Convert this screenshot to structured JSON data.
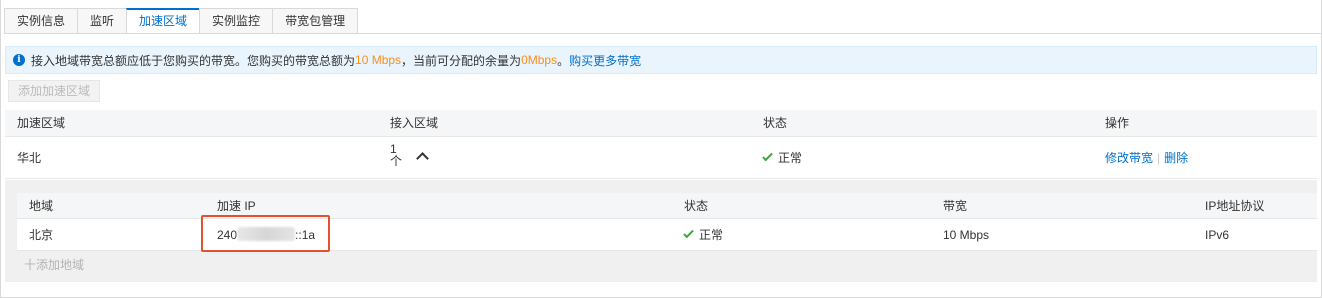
{
  "tabs": [
    {
      "label": "实例信息",
      "active": false
    },
    {
      "label": "监听",
      "active": false
    },
    {
      "label": "加速区域",
      "active": true
    },
    {
      "label": "实例监控",
      "active": false
    },
    {
      "label": "带宽包管理",
      "active": false
    }
  ],
  "notice": {
    "text_1": "接入地域带宽总额应低于您购买的带宽。您购买的带宽总额为",
    "purchased": "10 Mbps",
    "text_2": "，当前可分配的余量为",
    "remaining": "0Mbps",
    "text_3": "。",
    "buy_link": "购买更多带宽"
  },
  "add_region_button": "添加加速区域",
  "main_table": {
    "headers": [
      "加速区域",
      "接入区域",
      "状态",
      "操作"
    ],
    "row": {
      "region": "华北",
      "count_value": "1",
      "count_unit": "个",
      "status": "正常",
      "action_modify": "修改带宽",
      "action_separator": "|",
      "action_delete": "删除"
    }
  },
  "sub_table": {
    "headers": [
      "地域",
      "加速 IP",
      "状态",
      "带宽",
      "IP地址协议"
    ],
    "row": {
      "region": "北京",
      "ip_prefix": "240",
      "ip_suffix": "::1a",
      "status": "正常",
      "bandwidth": "10 Mbps",
      "protocol": "IPv6"
    },
    "add_area": "十添加地域"
  },
  "colors": {
    "accent": "#0070cc",
    "highlight": "#f98e1a",
    "success": "#3fa33f",
    "annotation_box": "#e0532e"
  }
}
